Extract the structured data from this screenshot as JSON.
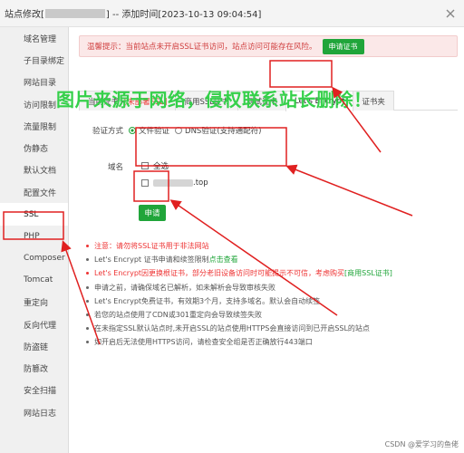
{
  "window": {
    "title_prefix": "站点修改[",
    "title_suffix": "] -- 添加时间[2023-10-13 09:04:54]"
  },
  "sidebar": {
    "items": [
      {
        "label": "域名管理"
      },
      {
        "label": "子目录绑定"
      },
      {
        "label": "网站目录"
      },
      {
        "label": "访问限制"
      },
      {
        "label": "流量限制"
      },
      {
        "label": "伪静态"
      },
      {
        "label": "默认文档"
      },
      {
        "label": "配置文件"
      },
      {
        "label": "SSL"
      },
      {
        "label": "PHP"
      },
      {
        "label": "Composer"
      },
      {
        "label": "Tomcat"
      },
      {
        "label": "重定向"
      },
      {
        "label": "反向代理"
      },
      {
        "label": "防盗链"
      },
      {
        "label": "防篡改"
      },
      {
        "label": "安全扫描"
      },
      {
        "label": "网站日志"
      }
    ]
  },
  "notice": {
    "text": "温馨提示：当前站点未开启SSL证书访问，站点访问可能存在风险。",
    "button": "申请证书"
  },
  "tabs": {
    "current_prefix": "当前证书 - ",
    "current_status": "[未部署SSL]",
    "commercial": "商用SSL证书",
    "test": "测试证书",
    "letsencrypt": "Let's Encrypt",
    "folder": "证书夹"
  },
  "watermark": "图片来源于网络，侵权联系站长删除！",
  "verify": {
    "label": "验证方式",
    "option_file": "文件验证",
    "option_dns": "DNS验证(支持通配符)"
  },
  "domain": {
    "label": "域名",
    "select_all": "全选",
    "suffix": ".top"
  },
  "apply_button": "申请",
  "tips": [
    {
      "text": "注意：请勿将SSL证书用于非法网站",
      "red": true
    },
    {
      "text": "Let's Encrypt 证书申请和续签限制 ",
      "link": "点击查看"
    },
    {
      "text": "Let's Encrypt因更换根证书，部分老旧设备访问时可能提示不可信，考虑购买",
      "link": "[商用SSL证书]",
      "red": true
    },
    {
      "text": "申请之前，请确保域名已解析，如未解析会导致审核失败"
    },
    {
      "text": "Let's Encrypt免费证书，有效期3个月，支持多域名。默认会自动续签"
    },
    {
      "text": "若您的站点使用了CDN或301重定向会导致续签失败"
    },
    {
      "text": "在未指定SSL默认站点时,未开启SSL的站点使用HTTPS会直接访问到已开启SSL的站点"
    },
    {
      "text": "如开启后无法使用HTTPS访问，请检查安全组是否正确放行443端口"
    }
  ],
  "footer": "CSDN @爱学习的鱼佬",
  "colors": {
    "accent_green": "#20a53a",
    "annotation_red": "#e02020",
    "warning_red": "#e33333"
  }
}
